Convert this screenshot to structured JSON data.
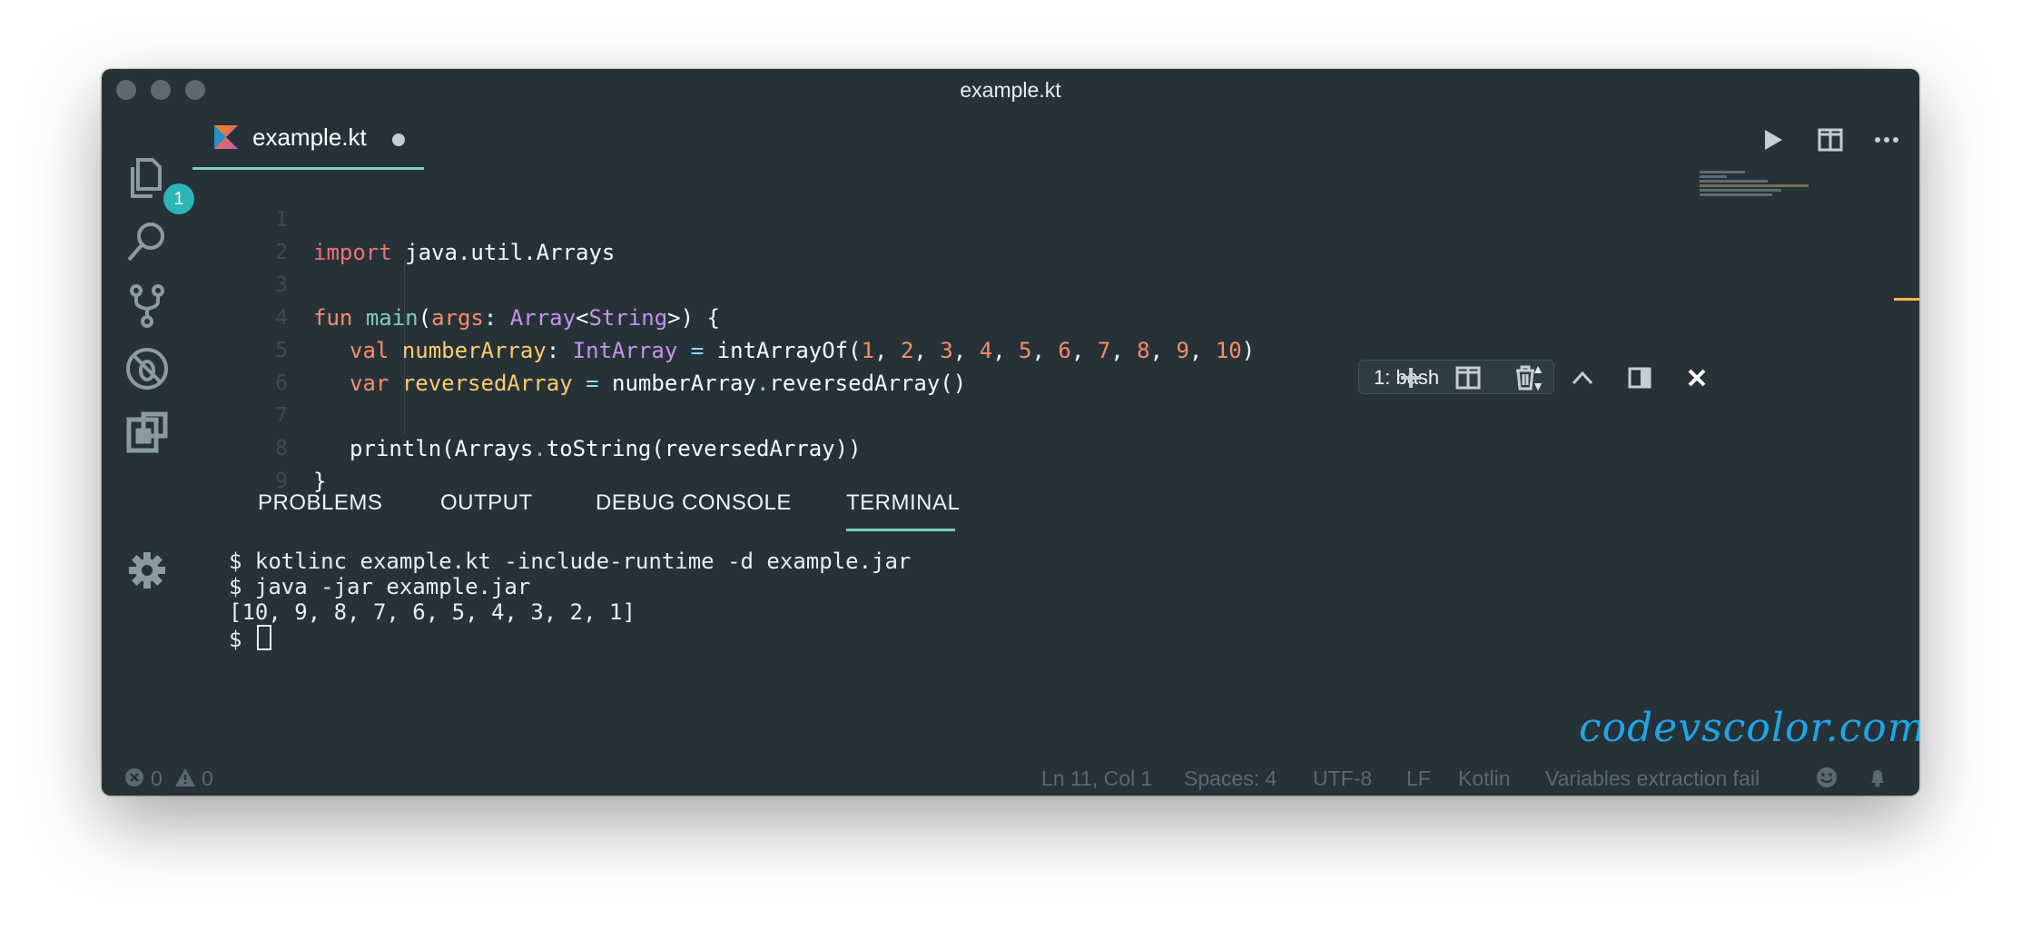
{
  "window": {
    "title": "example.kt"
  },
  "activity_bar": {
    "explorer_badge": "1"
  },
  "tab": {
    "label": "example.kt",
    "icon": "kotlin-icon"
  },
  "editor": {
    "line_numbers": [
      "1",
      "2",
      "3",
      "4",
      "5",
      "6",
      "7",
      "8",
      "9"
    ],
    "lines": {
      "l1": {
        "kw": "import",
        "rest": " java.util.Arrays"
      },
      "l3": {
        "kw": "fun",
        "name": "main",
        "p1": "(",
        "param": "args",
        "colon": ": ",
        "type1": "Array",
        "lt": "<",
        "type2": "String",
        "gt": ">",
        "end": ") {"
      },
      "l4": {
        "kw": "val",
        "name": "numberArray",
        "colon": ": ",
        "type": "IntArray",
        "eq": " = ",
        "call": "intArrayOf(",
        "nums": [
          "1",
          "2",
          "3",
          "4",
          "5",
          "6",
          "7",
          "8",
          "9",
          "10"
        ],
        "sep": ", ",
        "close": ")"
      },
      "l5": {
        "kw": "var",
        "name": "reversedArray",
        "eq": " = ",
        "obj": "numberArray",
        "dot": ".",
        "call": "reversedArray()"
      },
      "l7": {
        "a": "println(Arrays",
        "dot": ".",
        "b": "toString(reversedArray))"
      },
      "l8": {
        "text": "}"
      }
    }
  },
  "panel": {
    "tabs": [
      "PROBLEMS",
      "OUTPUT",
      "DEBUG CONSOLE",
      "TERMINAL"
    ],
    "active_tab": "TERMINAL",
    "terminal_select": "1: bash",
    "terminal_lines": [
      "$ kotlinc example.kt -include-runtime -d example.jar",
      "$ java -jar example.jar",
      "[10, 9, 8, 7, 6, 5, 4, 3, 2, 1]",
      "$ "
    ]
  },
  "watermark": "codevscolor.com",
  "status_bar": {
    "errors": "0",
    "warnings": "0",
    "position": "Ln 11, Col 1",
    "spaces": "Spaces: 4",
    "encoding": "UTF-8",
    "eol": "LF",
    "language": "Kotlin",
    "message": "Variables extraction fail"
  },
  "colors": {
    "background": "#263238",
    "accent": "#80cbc4",
    "badge": "#2bb5b8",
    "watermark": "#1ea5e6"
  }
}
